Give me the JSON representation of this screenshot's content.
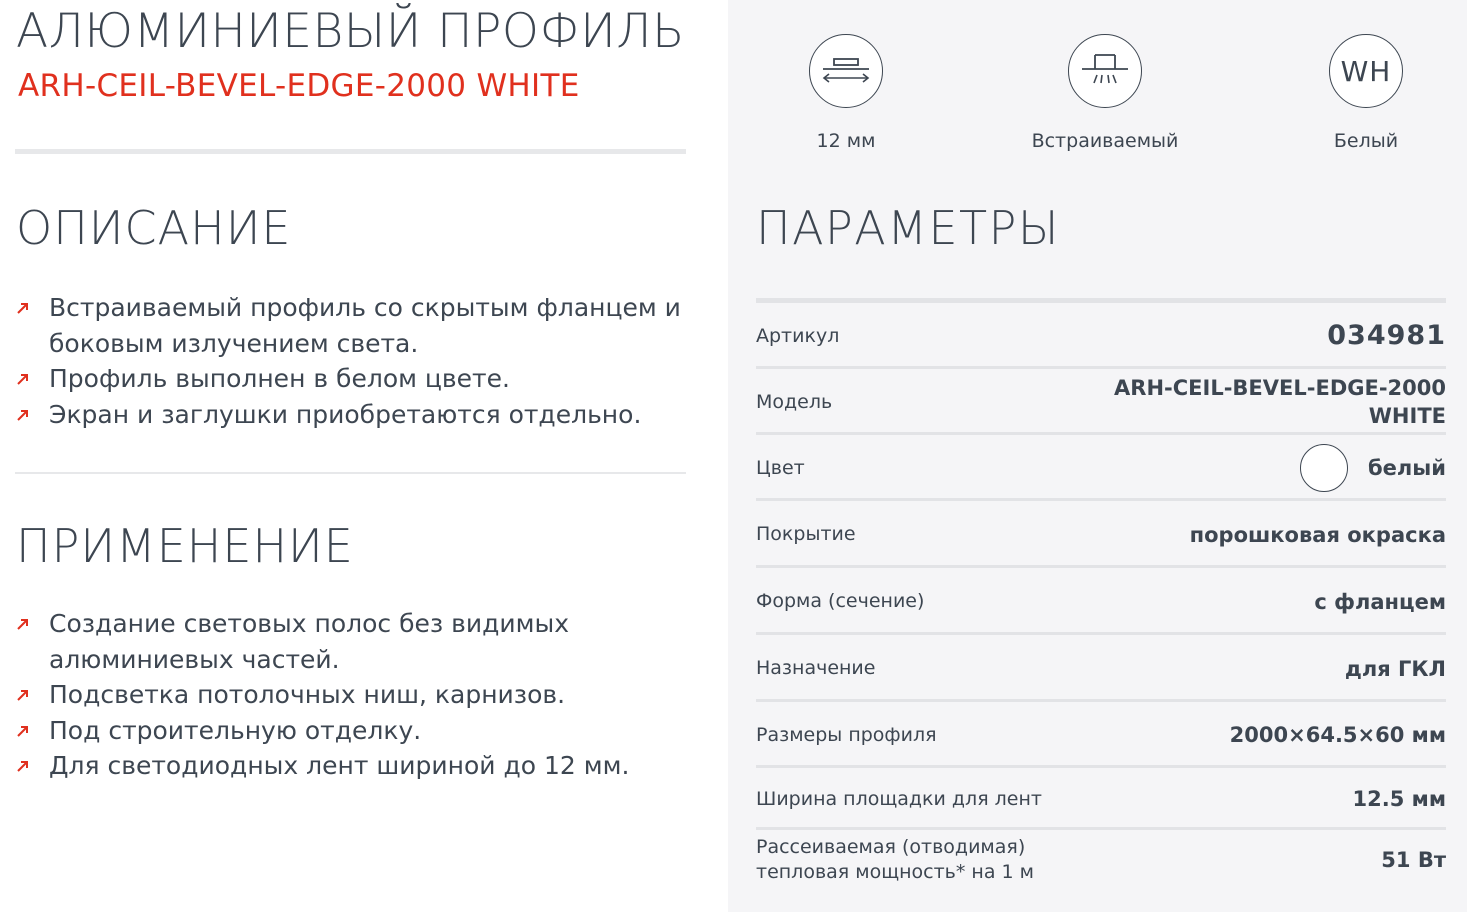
{
  "header": {
    "title": "АЛЮМИНИЕВЫЙ ПРОФИЛЬ",
    "subtitle": "ARH-CEIL-BEVEL-EDGE-2000 WHITE"
  },
  "colors": {
    "accent": "#e0301e",
    "text": "#3d4651",
    "panel_bg": "#f5f5f7",
    "divider": "#e2e3e6"
  },
  "description": {
    "title": "ОПИСАНИЕ",
    "items": [
      "Встраиваемый профиль со скрытым фланцем и боковым излучением света.",
      "Профиль выполнен в белом цвете.",
      "Экран и заглушки приобретаются отдельно."
    ]
  },
  "application": {
    "title": "ПРИМЕНЕНИЕ",
    "items": [
      "Создание световых полос без видимых алюминиевых частей.",
      "Подсветка потолочных ниш, карнизов.",
      "Под строительную отделку.",
      "Для светодиодных лент шириной до 12 мм."
    ]
  },
  "features": [
    {
      "icon": "width-arrows-icon",
      "label": "12 мм"
    },
    {
      "icon": "recessed-light-icon",
      "label": "Встраиваемый"
    },
    {
      "icon": "white-color-icon",
      "badge": "WH",
      "label": "Белый"
    }
  ],
  "params": {
    "title": "ПАРАМЕТРЫ",
    "rows": [
      {
        "label": "Артикул",
        "value": "034981"
      },
      {
        "label": "Модель",
        "value": "ARH-CEIL-BEVEL-EDGE-2000 WHITE"
      },
      {
        "label": "Цвет",
        "value": "белый",
        "swatch": "#ffffff"
      },
      {
        "label": "Покрытие",
        "value": "порошковая окраска"
      },
      {
        "label": "Форма (сечение)",
        "value": "с фланцем"
      },
      {
        "label": "Назначение",
        "value": "для ГКЛ"
      },
      {
        "label": "Размеры профиля",
        "value": "2000×64.5×60 мм"
      },
      {
        "label": "Ширина площадки для лент",
        "value": "12.5 мм"
      },
      {
        "label": "Рассеиваемая (отводимая) тепловая мощность* на 1 м",
        "value": "51 Вт"
      }
    ]
  }
}
